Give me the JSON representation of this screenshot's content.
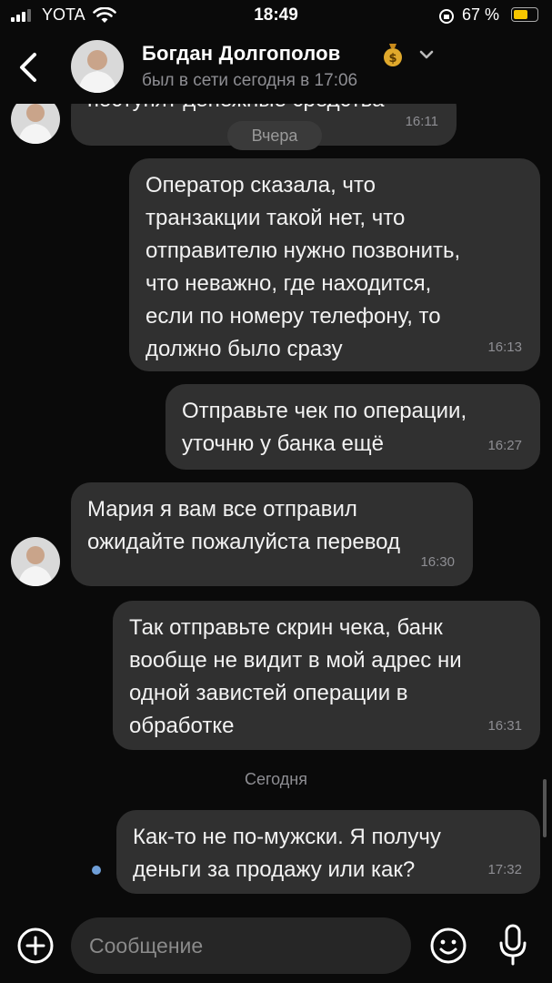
{
  "status_bar": {
    "carrier": "YOTA",
    "time": "18:49",
    "battery": "67 %"
  },
  "header": {
    "back_icon": "chevron-left-icon",
    "contact_name": "Богдан Долгополов",
    "badge_icon": "money-bag-icon",
    "last_seen": "был в сети сегодня в 17:06"
  },
  "messages": [
    {
      "side": "in",
      "text": "поступят денежные средства",
      "time": "16:11"
    },
    {
      "side": "day",
      "label": "Вчера"
    },
    {
      "side": "out",
      "text": "Оператор сказала, что\nтранзакции такой нет, что\nотправителю нужно позвонить,\nчто неважно, где находится,\nесли по номеру телефону, то\nдолжно было сразу",
      "time": "16:13"
    },
    {
      "side": "out",
      "text": "Отправьте чек по операции,\nуточню у банка ещё",
      "time": "16:27"
    },
    {
      "side": "in",
      "text": "Мария я вам все отправил\nожидайте пожалуйста перевод",
      "time": "16:30"
    },
    {
      "side": "out",
      "text": "Так отправьте скрин чека, банк\nвообще не видит в мой адрес ни\nодной завистей операции в\nобработке",
      "time": "16:31"
    },
    {
      "side": "day",
      "label": "Сегодня"
    },
    {
      "side": "out",
      "text": "Как-то не по-мужски. Я получу\nденьги за продажу или как?",
      "time": "17:32",
      "unread": true
    }
  ],
  "composer": {
    "placeholder": "Сообщение",
    "attach_icon": "plus-circle-icon",
    "emoji_icon": "smiley-icon",
    "mic_icon": "microphone-icon"
  },
  "colors": {
    "background": "#0a0a0a",
    "bubble": "#303030",
    "meta_text": "#8e8e93",
    "unread_dot": "#6f9fd8"
  }
}
